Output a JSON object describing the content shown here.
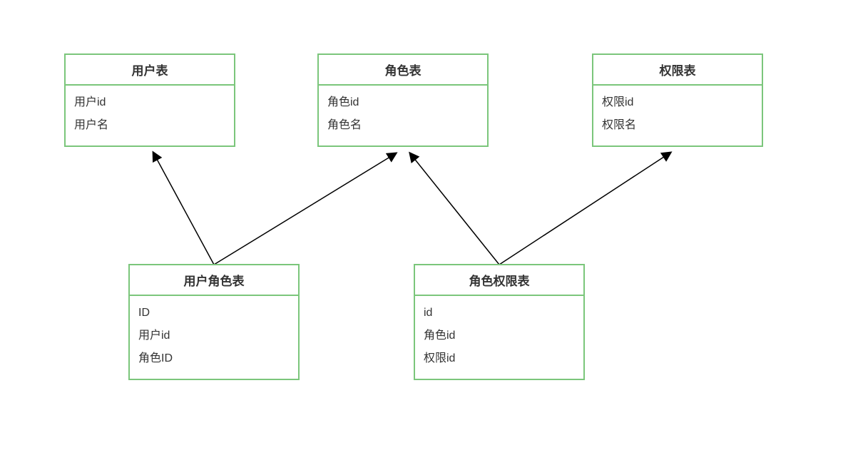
{
  "entities": {
    "user": {
      "title": "用户表",
      "fields": [
        "用户id",
        "用户名"
      ]
    },
    "role": {
      "title": "角色表",
      "fields": [
        "角色id",
        "角色名"
      ]
    },
    "permission": {
      "title": "权限表",
      "fields": [
        "权限id",
        "权限名"
      ]
    },
    "userRole": {
      "title": "用户角色表",
      "fields": [
        "ID",
        "用户id",
        "角色ID"
      ]
    },
    "rolePermission": {
      "title": "角色权限表",
      "fields": [
        "id",
        "角色id",
        "权限id"
      ]
    }
  }
}
